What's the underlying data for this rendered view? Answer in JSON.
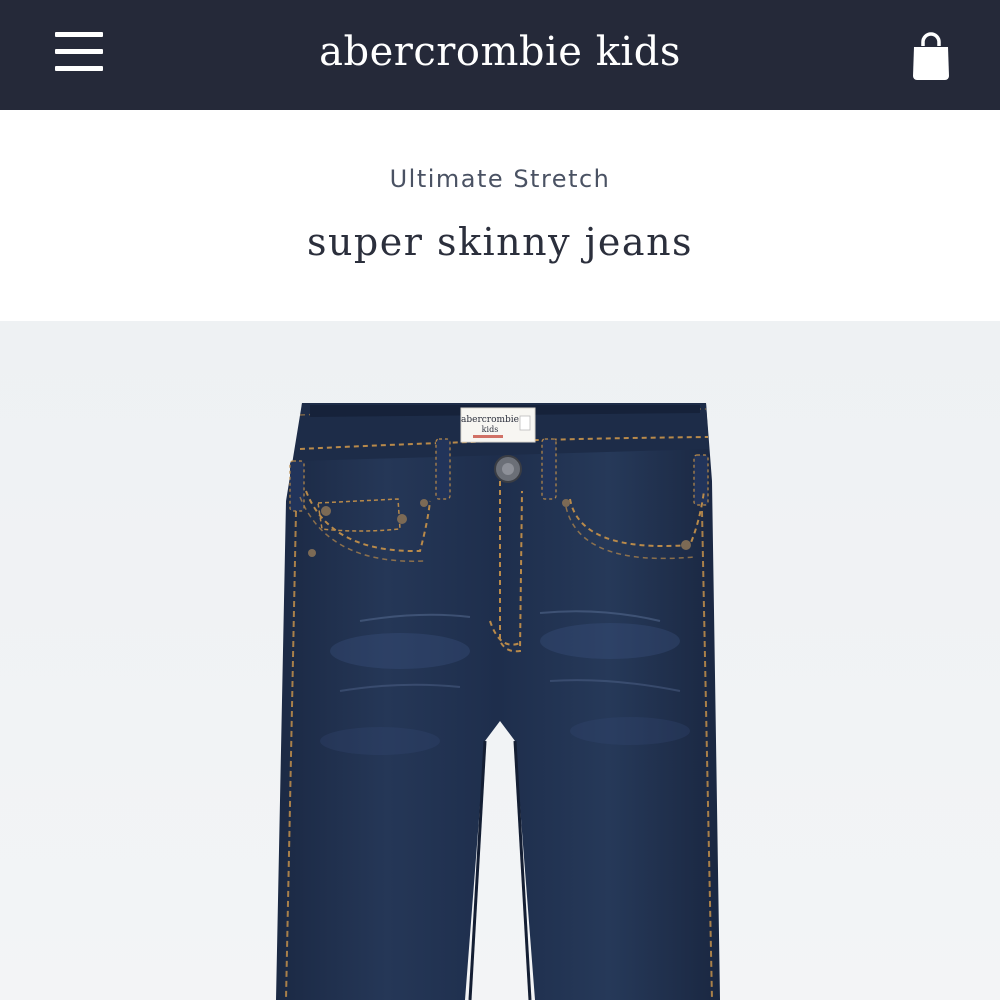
{
  "header": {
    "brand": "abercrombie kids",
    "menu_icon": "hamburger-menu-icon",
    "bag_icon": "shopping-bag-icon"
  },
  "product": {
    "collection": "Ultimate Stretch",
    "name": "super skinny jeans",
    "image_subject": "jeans-product-photo",
    "label": {
      "line1": "abercrombie",
      "line2": "kids"
    }
  },
  "colors": {
    "header_bg": "#252939",
    "denim": "#1e2d4a",
    "stitch": "#b98a4a",
    "photo_bg": "#eff1f3"
  }
}
